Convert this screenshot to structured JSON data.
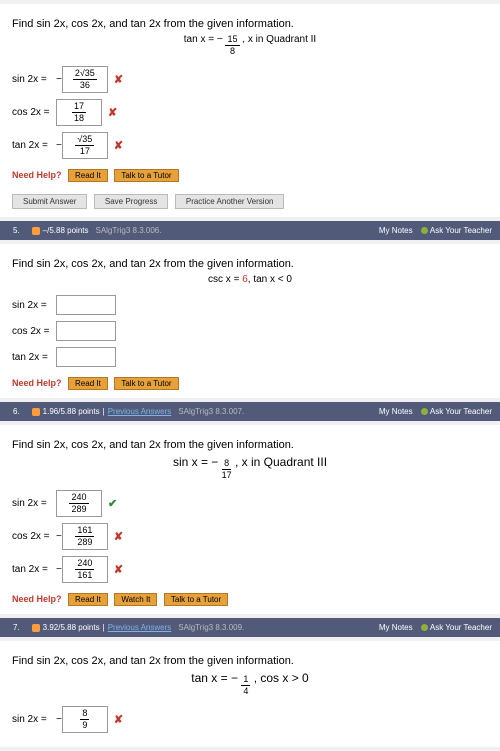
{
  "common": {
    "prompt": "Find sin 2x, cos 2x, and tan 2x from the given information.",
    "sin2x": "sin 2x =",
    "cos2x": "cos 2x =",
    "tan2x": "tan 2x =",
    "need_help": "Need Help?",
    "read_it": "Read It",
    "watch_it": "Watch It",
    "talk": "Talk to a Tutor",
    "my_notes": "My Notes",
    "ask": "Ask Your Teacher",
    "prev": "Previous Answers",
    "neg": "−"
  },
  "q4": {
    "given_a": "tan x = −",
    "given_num": "15",
    "given_den": "8",
    "given_b": ",   x in Quadrant II",
    "sin_num": "2√35",
    "sin_den": "36",
    "cos_num": "17",
    "cos_den": "18",
    "tan_num": "√35",
    "tan_den": "17",
    "submit": "Submit Answer",
    "save": "Save Progress",
    "practice": "Practice Another Version"
  },
  "q5": {
    "num": "5.",
    "pts": "–/5.88 points",
    "src": "SAlgTrig3 8.3.006.",
    "given": "csc x = ",
    "given_val": "6",
    "given2": ",   tan x < 0"
  },
  "q6": {
    "num": "6.",
    "pts": "1.96/5.88 points",
    "src": "SAlgTrig3 8.3.007.",
    "given_a": "sin x = −",
    "given_num": "8",
    "given_den": "17",
    "given_b": ",   x in Quadrant III",
    "sin_num": "240",
    "sin_den": "289",
    "cos_num": "161",
    "cos_den": "289",
    "tan_num": "240",
    "tan_den": "161"
  },
  "q7": {
    "num": "7.",
    "pts": "3.92/5.88 points",
    "src": "SAlgTrig3 8.3.009.",
    "given_a": "tan x = −",
    "given_num": "1",
    "given_den": "4",
    "given_b": ",   cos x > 0",
    "sin_num": "8",
    "sin_den": "9"
  }
}
